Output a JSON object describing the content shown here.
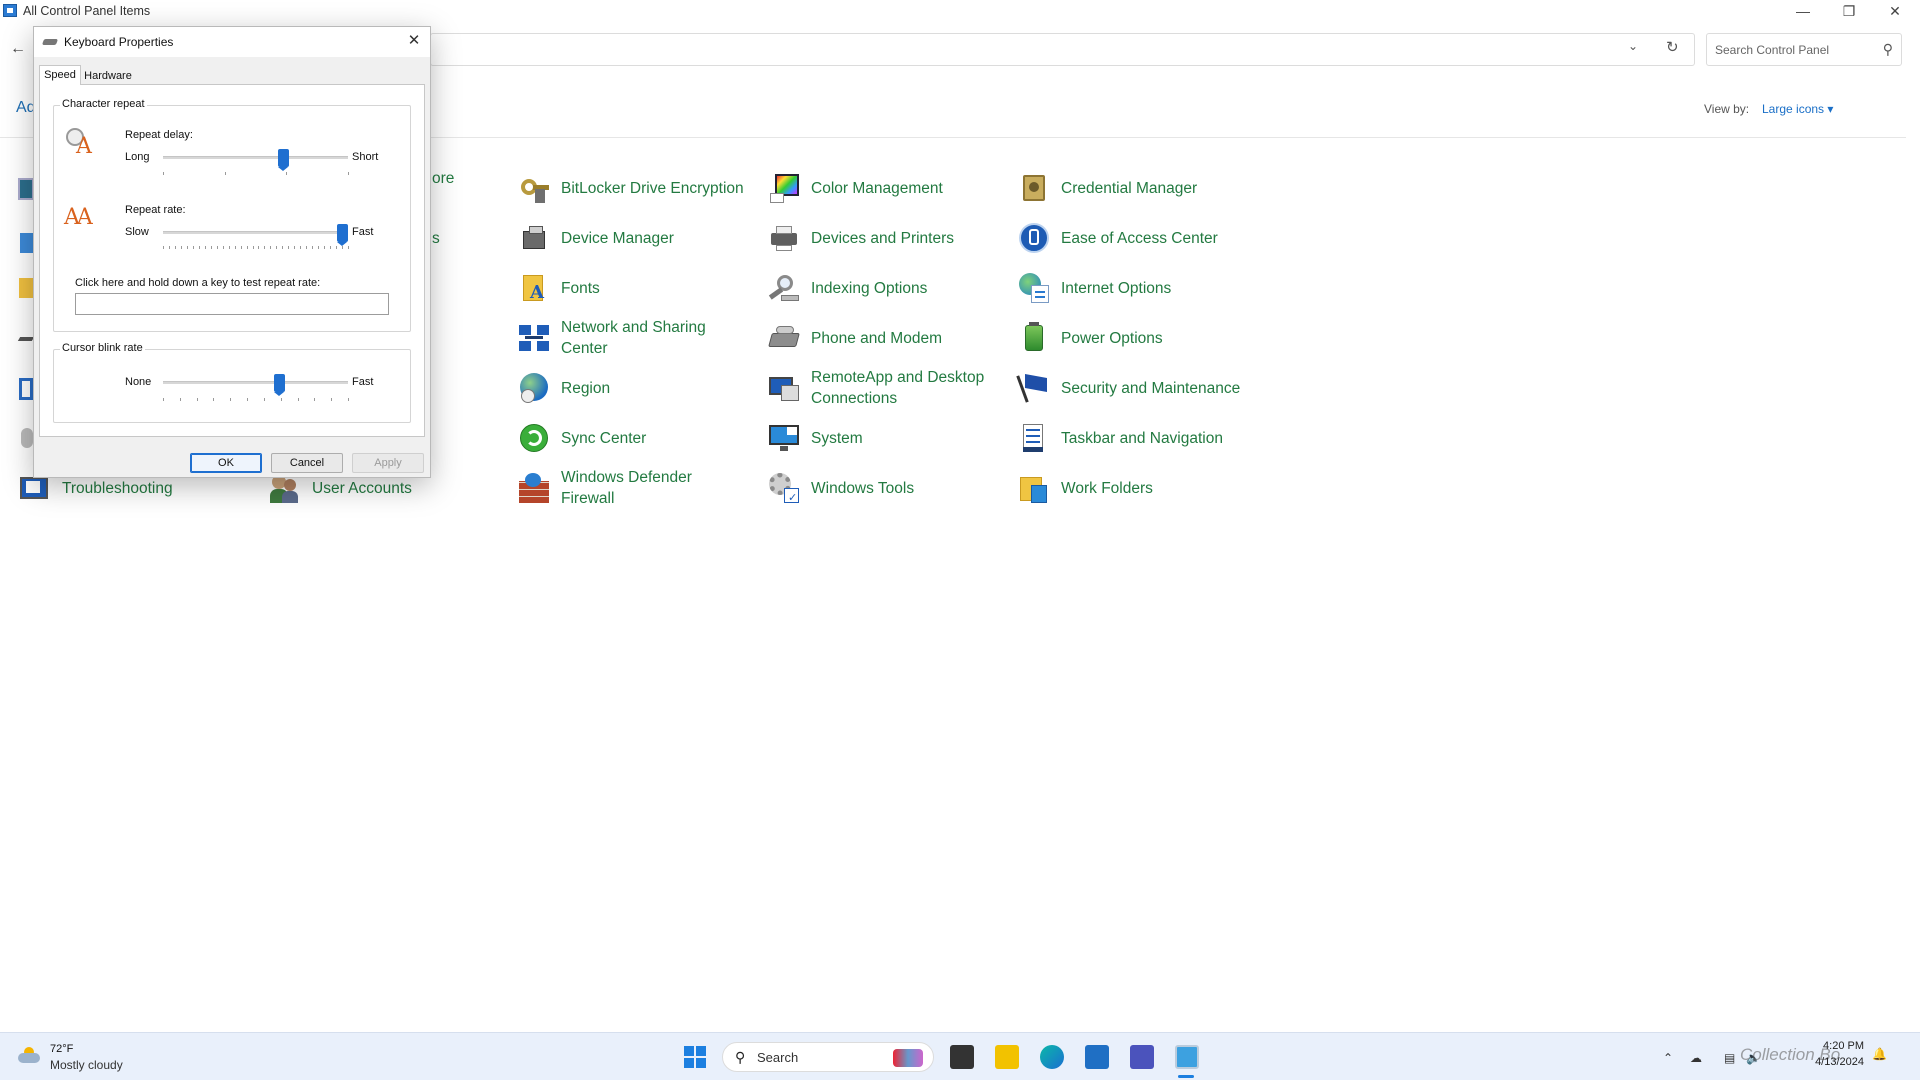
{
  "window": {
    "title": "All Control Panel Items",
    "search_placeholder": "Search Control Panel",
    "heading_partial": "Ad",
    "view_by_label": "View by:",
    "view_by_value": "Large icons"
  },
  "items": [
    {
      "label": "BitLocker Drive Encryption",
      "icon": "bitlocker-icon"
    },
    {
      "label": "Color Management",
      "icon": "color-management-icon"
    },
    {
      "label": "Credential Manager",
      "icon": "credential-manager-icon"
    },
    {
      "label": "Device Manager",
      "icon": "device-manager-icon"
    },
    {
      "label": "Devices and Printers",
      "icon": "devices-printers-icon"
    },
    {
      "label": "Ease of Access Center",
      "icon": "ease-of-access-icon"
    },
    {
      "label": "Fonts",
      "icon": "fonts-icon"
    },
    {
      "label": "Indexing Options",
      "icon": "indexing-icon"
    },
    {
      "label": "Internet Options",
      "icon": "internet-options-icon"
    },
    {
      "label": "Network and Sharing Center",
      "icon": "network-sharing-icon"
    },
    {
      "label": "Phone and Modem",
      "icon": "phone-modem-icon"
    },
    {
      "label": "Power Options",
      "icon": "power-options-icon"
    },
    {
      "label": "Region",
      "icon": "region-icon"
    },
    {
      "label": "RemoteApp and Desktop Connections",
      "icon": "remoteapp-icon"
    },
    {
      "label": "Security and Maintenance",
      "icon": "security-flag-icon"
    },
    {
      "label": "Sync Center",
      "icon": "sync-center-icon"
    },
    {
      "label": "System",
      "icon": "system-icon"
    },
    {
      "label": "Taskbar and Navigation",
      "icon": "taskbar-navigation-icon"
    },
    {
      "label": "Windows Defender Firewall",
      "icon": "firewall-icon"
    },
    {
      "label": "Windows Tools",
      "icon": "windows-tools-icon"
    },
    {
      "label": "Work Folders",
      "icon": "work-folders-icon"
    },
    {
      "label": "Troubleshooting",
      "icon": "troubleshooting-icon"
    },
    {
      "label": "User Accounts",
      "icon": "user-accounts-icon"
    }
  ],
  "partial_labels": {
    "ore": "ore",
    "s": "s"
  },
  "dialog": {
    "title": "Keyboard Properties",
    "tabs": [
      "Speed",
      "Hardware"
    ],
    "char_repeat": {
      "legend": "Character repeat",
      "repeat_delay_label": "Repeat delay:",
      "delay_min": "Long",
      "delay_max": "Short",
      "delay_value_fraction": 0.65,
      "repeat_rate_label": "Repeat rate:",
      "rate_min": "Slow",
      "rate_max": "Fast",
      "rate_value_fraction": 0.97,
      "test_label": "Click here and hold down a key to test repeat rate:"
    },
    "cursor_blink": {
      "legend": "Cursor blink rate",
      "min": "None",
      "max": "Fast",
      "value_fraction": 0.63
    },
    "buttons": {
      "ok": "OK",
      "cancel": "Cancel",
      "apply": "Apply"
    }
  },
  "taskbar": {
    "temperature": "72°F",
    "condition": "Mostly cloudy",
    "search_label": "Search",
    "time": "4:20 PM",
    "date": "4/13/2024",
    "watermark": "Collection Bo"
  }
}
